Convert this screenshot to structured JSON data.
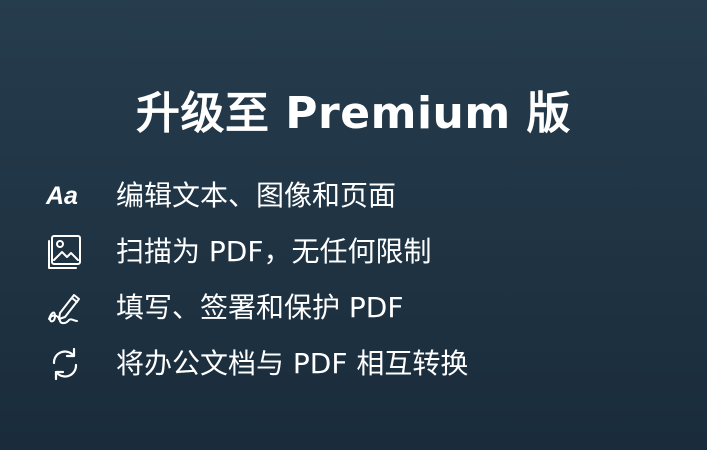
{
  "promo": {
    "title": "升级至 Premium 版",
    "features": [
      {
        "icon": "text-aa-icon",
        "icon_text": "Aa",
        "label": "编辑文本、图像和页面"
      },
      {
        "icon": "image-scan-icon",
        "label": "扫描为 PDF，无任何限制"
      },
      {
        "icon": "signature-pen-icon",
        "label": "填写、签署和保护 PDF"
      },
      {
        "icon": "convert-arrows-icon",
        "label": "将办公文档与 PDF 相互转换"
      }
    ]
  },
  "colors": {
    "background_top": "#263d4d",
    "background_bottom": "#1a2c3b",
    "text": "#ffffff"
  }
}
